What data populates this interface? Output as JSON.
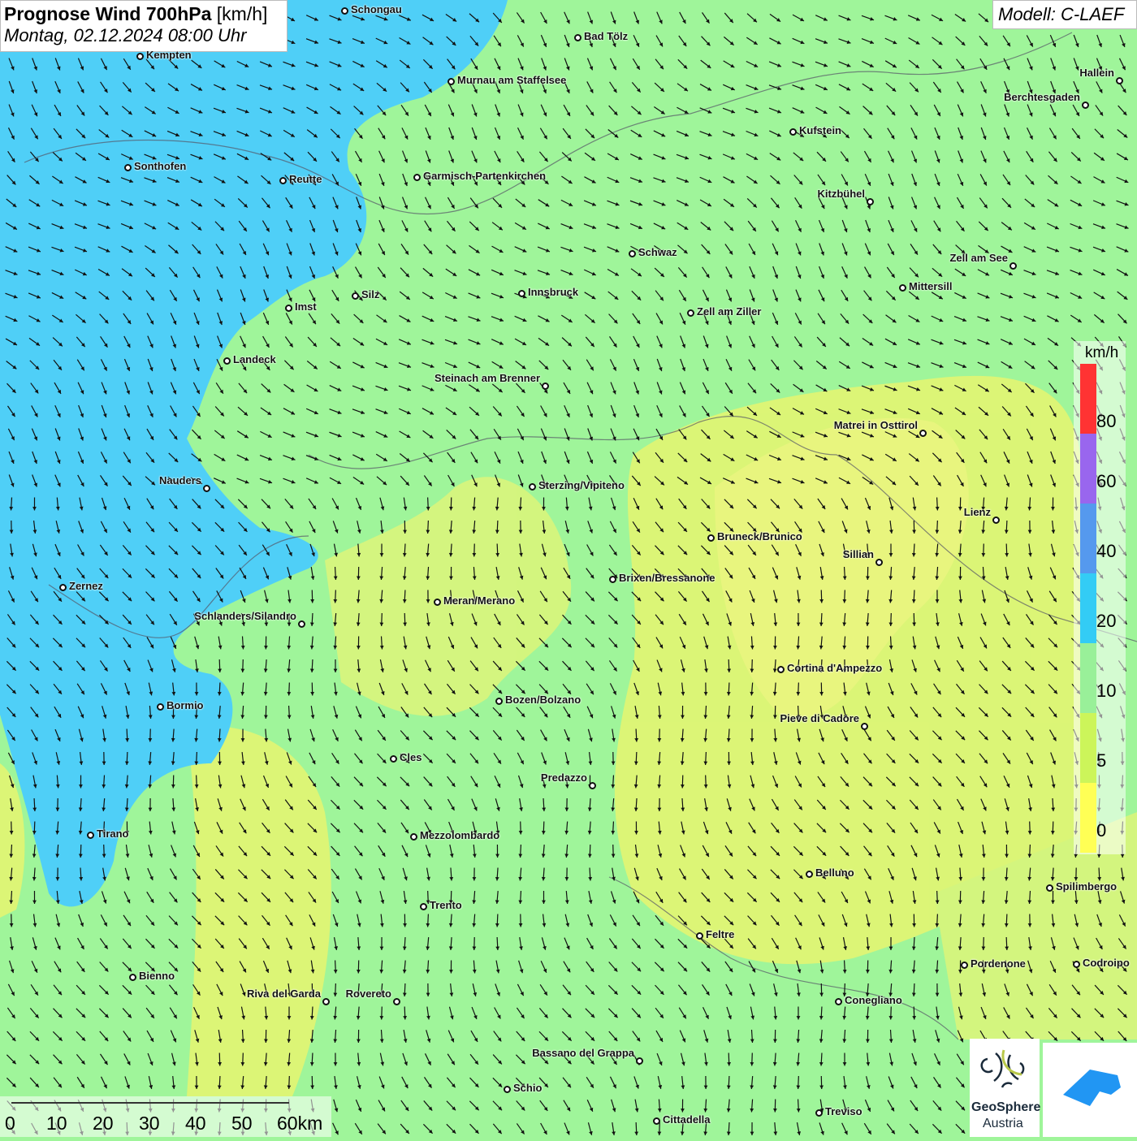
{
  "header": {
    "title": "Prognose Wind 700hPa",
    "unit": "[km/h]",
    "datetime": "Montag, 02.12.2024 08:00 Uhr"
  },
  "model": "Modell: C-LAEF",
  "legend": {
    "unit": "km/h",
    "ticks": [
      "80",
      "60",
      "40",
      "20",
      "10",
      "5",
      "0"
    ],
    "colors": [
      "#ff3333",
      "#9966ee",
      "#5599ee",
      "#33ccf5",
      "#99f099",
      "#ccf55a",
      "#ffff55"
    ]
  },
  "colors": {
    "background": "#9ff59a",
    "low_wind": "#f5f57a",
    "high_wind": "#4fcff7"
  },
  "scale": {
    "labels": [
      "0",
      "10",
      "20",
      "30",
      "40",
      "50",
      "60km"
    ]
  },
  "logos": {
    "geosphere": "GeoSphere",
    "geosphere_sub": "Austria"
  },
  "cities": [
    "Schongau",
    "Bad Tölz",
    "Kempten",
    "Murnau am Staffelsee",
    "Hallein",
    "Berchtesgaden",
    "Kufstein",
    "Sonthofen",
    "Reutte",
    "Garmisch-Partenkirchen",
    "Kitzbühel",
    "Schwaz",
    "Zell am See",
    "Mittersill",
    "Innsbruck",
    "Silz",
    "Imst",
    "Zell am Ziller",
    "Landeck",
    "Steinach am Brenner",
    "Matrei in Osttirol",
    "Nauders",
    "Sterzing/Vipiteno",
    "Lienz",
    "Bruneck/Brunico",
    "Sillian",
    "Brixen/Bressanone",
    "Zernez",
    "Meran/Merano",
    "Schlanders/Silandro",
    "Cortina d'Ampezzo",
    "Bozen/Bolzano",
    "Bormio",
    "Pieve di Cadore",
    "Cles",
    "Predazzo",
    "Tirano",
    "Mezzolombardo",
    "Belluno",
    "Spilimbergo",
    "Trento",
    "Feltre",
    "Pordenone",
    "Codroipo",
    "Bienno",
    "Riva del Garda",
    "Rovereto",
    "Conegliano",
    "Bassano del Grappa",
    "Schio",
    "Treviso",
    "Cittadella"
  ],
  "wind_direction": "north-west"
}
